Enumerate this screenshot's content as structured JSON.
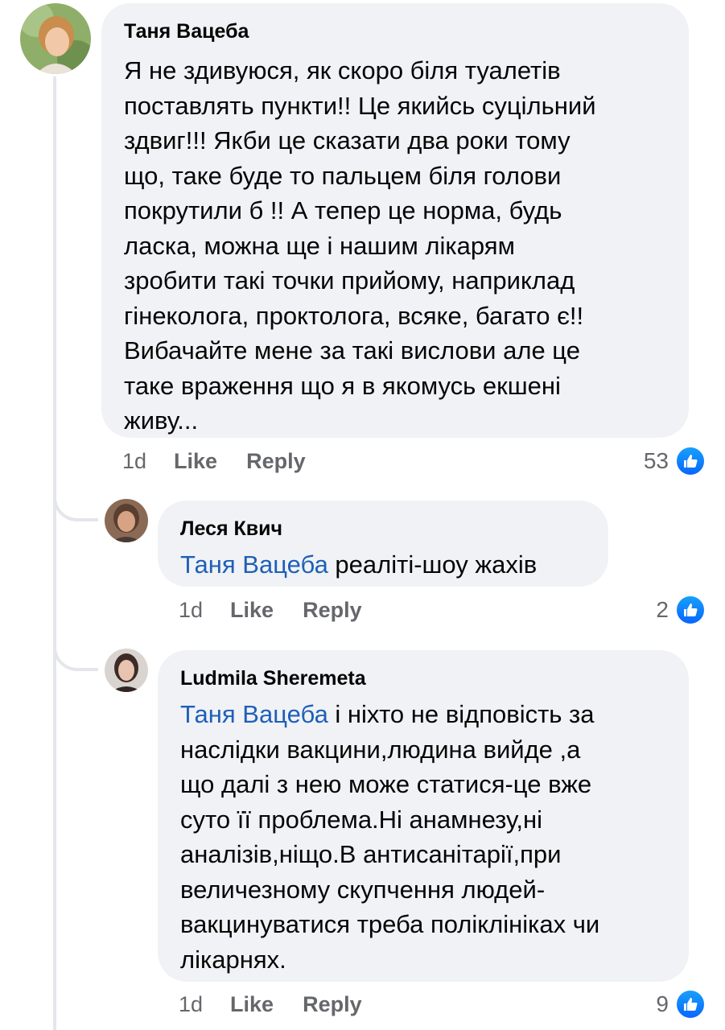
{
  "colors": {
    "bubble": "#f0f2f5",
    "mention": "#1f5fb8",
    "meta": "#65676b",
    "like": "#0866ff"
  },
  "comments": [
    {
      "author": "Таня Вацеба",
      "lines": [
        "Я не здивуюся, як скоро біля туалетів",
        "поставлять пункти!! Це якийсь суцільний",
        "здвиг!!! Якби це сказати два роки тому",
        "що, таке буде то пальцем біля голови",
        "покрутили б !! А тепер це норма, будь",
        "ласка, можна ще і нашим лікарям",
        "зробити такі точки прийому, наприклад",
        "гінеколога, проктолога, всяке, багато є!!",
        "Вибачайте мене за такі вислови але це",
        "таке враження що я в якомусь екшені",
        "живу..."
      ],
      "time": "1d",
      "like": "Like",
      "reply": "Reply",
      "reactions": "53"
    },
    {
      "author": "Леся Квич",
      "mention": "Таня Вацеба",
      "lines": [
        " реаліті-шоу жахів"
      ],
      "time": "1d",
      "like": "Like",
      "reply": "Reply",
      "reactions": "2"
    },
    {
      "author": "Ludmila Sheremeta",
      "mention": "Таня Вацеба",
      "lines": [
        " і ніхто не відповість за",
        "наслідки вакцини,людина вийде ,а",
        "що далі з нею може статися-це вже",
        "суто її проблема.Ні анамнезу,ні",
        "аналізів,ніщо.В антисанітарії,при",
        "величезному скупчення людей-",
        "вакцинуватися треба поліклініках чи",
        "лікарнях."
      ],
      "time": "1d",
      "like": "Like",
      "reply": "Reply",
      "reactions": "9"
    }
  ]
}
